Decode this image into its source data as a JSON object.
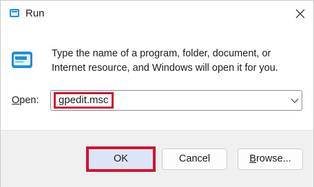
{
  "window": {
    "title": "Run",
    "app_icon": "run-icon",
    "close_icon": "close-icon"
  },
  "content": {
    "description_line1": "Type the name of a program, folder, document, or",
    "description_line2": "Internet resource, and Windows will open it for you.",
    "big_icon": "run-program-icon"
  },
  "open_field": {
    "label_underlined": "O",
    "label_rest": "pen:",
    "value": "gpedit.msc",
    "dropdown_icon": "chevron-down-icon"
  },
  "buttons": {
    "ok": "OK",
    "cancel": "Cancel",
    "browse_underlined": "B",
    "browse_rest": "rowse..."
  },
  "colors": {
    "highlight": "#d0132f",
    "ok_background": "#dbe6f5",
    "footer_background": "#f0f0f0"
  }
}
